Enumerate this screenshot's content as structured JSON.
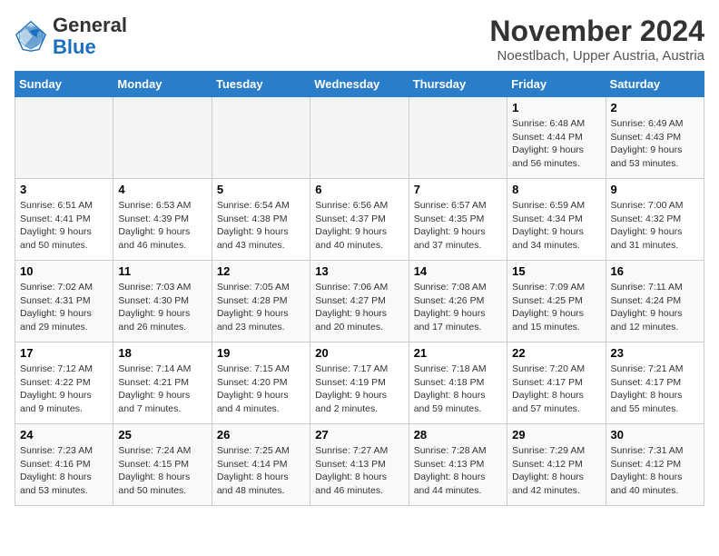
{
  "header": {
    "logo_general": "General",
    "logo_blue": "Blue",
    "title": "November 2024",
    "location": "Noestlbach, Upper Austria, Austria"
  },
  "days_of_week": [
    "Sunday",
    "Monday",
    "Tuesday",
    "Wednesday",
    "Thursday",
    "Friday",
    "Saturday"
  ],
  "weeks": [
    [
      {
        "day": "",
        "info": ""
      },
      {
        "day": "",
        "info": ""
      },
      {
        "day": "",
        "info": ""
      },
      {
        "day": "",
        "info": ""
      },
      {
        "day": "",
        "info": ""
      },
      {
        "day": "1",
        "info": "Sunrise: 6:48 AM\nSunset: 4:44 PM\nDaylight: 9 hours and 56 minutes."
      },
      {
        "day": "2",
        "info": "Sunrise: 6:49 AM\nSunset: 4:43 PM\nDaylight: 9 hours and 53 minutes."
      }
    ],
    [
      {
        "day": "3",
        "info": "Sunrise: 6:51 AM\nSunset: 4:41 PM\nDaylight: 9 hours and 50 minutes."
      },
      {
        "day": "4",
        "info": "Sunrise: 6:53 AM\nSunset: 4:39 PM\nDaylight: 9 hours and 46 minutes."
      },
      {
        "day": "5",
        "info": "Sunrise: 6:54 AM\nSunset: 4:38 PM\nDaylight: 9 hours and 43 minutes."
      },
      {
        "day": "6",
        "info": "Sunrise: 6:56 AM\nSunset: 4:37 PM\nDaylight: 9 hours and 40 minutes."
      },
      {
        "day": "7",
        "info": "Sunrise: 6:57 AM\nSunset: 4:35 PM\nDaylight: 9 hours and 37 minutes."
      },
      {
        "day": "8",
        "info": "Sunrise: 6:59 AM\nSunset: 4:34 PM\nDaylight: 9 hours and 34 minutes."
      },
      {
        "day": "9",
        "info": "Sunrise: 7:00 AM\nSunset: 4:32 PM\nDaylight: 9 hours and 31 minutes."
      }
    ],
    [
      {
        "day": "10",
        "info": "Sunrise: 7:02 AM\nSunset: 4:31 PM\nDaylight: 9 hours and 29 minutes."
      },
      {
        "day": "11",
        "info": "Sunrise: 7:03 AM\nSunset: 4:30 PM\nDaylight: 9 hours and 26 minutes."
      },
      {
        "day": "12",
        "info": "Sunrise: 7:05 AM\nSunset: 4:28 PM\nDaylight: 9 hours and 23 minutes."
      },
      {
        "day": "13",
        "info": "Sunrise: 7:06 AM\nSunset: 4:27 PM\nDaylight: 9 hours and 20 minutes."
      },
      {
        "day": "14",
        "info": "Sunrise: 7:08 AM\nSunset: 4:26 PM\nDaylight: 9 hours and 17 minutes."
      },
      {
        "day": "15",
        "info": "Sunrise: 7:09 AM\nSunset: 4:25 PM\nDaylight: 9 hours and 15 minutes."
      },
      {
        "day": "16",
        "info": "Sunrise: 7:11 AM\nSunset: 4:24 PM\nDaylight: 9 hours and 12 minutes."
      }
    ],
    [
      {
        "day": "17",
        "info": "Sunrise: 7:12 AM\nSunset: 4:22 PM\nDaylight: 9 hours and 9 minutes."
      },
      {
        "day": "18",
        "info": "Sunrise: 7:14 AM\nSunset: 4:21 PM\nDaylight: 9 hours and 7 minutes."
      },
      {
        "day": "19",
        "info": "Sunrise: 7:15 AM\nSunset: 4:20 PM\nDaylight: 9 hours and 4 minutes."
      },
      {
        "day": "20",
        "info": "Sunrise: 7:17 AM\nSunset: 4:19 PM\nDaylight: 9 hours and 2 minutes."
      },
      {
        "day": "21",
        "info": "Sunrise: 7:18 AM\nSunset: 4:18 PM\nDaylight: 8 hours and 59 minutes."
      },
      {
        "day": "22",
        "info": "Sunrise: 7:20 AM\nSunset: 4:17 PM\nDaylight: 8 hours and 57 minutes."
      },
      {
        "day": "23",
        "info": "Sunrise: 7:21 AM\nSunset: 4:17 PM\nDaylight: 8 hours and 55 minutes."
      }
    ],
    [
      {
        "day": "24",
        "info": "Sunrise: 7:23 AM\nSunset: 4:16 PM\nDaylight: 8 hours and 53 minutes."
      },
      {
        "day": "25",
        "info": "Sunrise: 7:24 AM\nSunset: 4:15 PM\nDaylight: 8 hours and 50 minutes."
      },
      {
        "day": "26",
        "info": "Sunrise: 7:25 AM\nSunset: 4:14 PM\nDaylight: 8 hours and 48 minutes."
      },
      {
        "day": "27",
        "info": "Sunrise: 7:27 AM\nSunset: 4:13 PM\nDaylight: 8 hours and 46 minutes."
      },
      {
        "day": "28",
        "info": "Sunrise: 7:28 AM\nSunset: 4:13 PM\nDaylight: 8 hours and 44 minutes."
      },
      {
        "day": "29",
        "info": "Sunrise: 7:29 AM\nSunset: 4:12 PM\nDaylight: 8 hours and 42 minutes."
      },
      {
        "day": "30",
        "info": "Sunrise: 7:31 AM\nSunset: 4:12 PM\nDaylight: 8 hours and 40 minutes."
      }
    ]
  ]
}
